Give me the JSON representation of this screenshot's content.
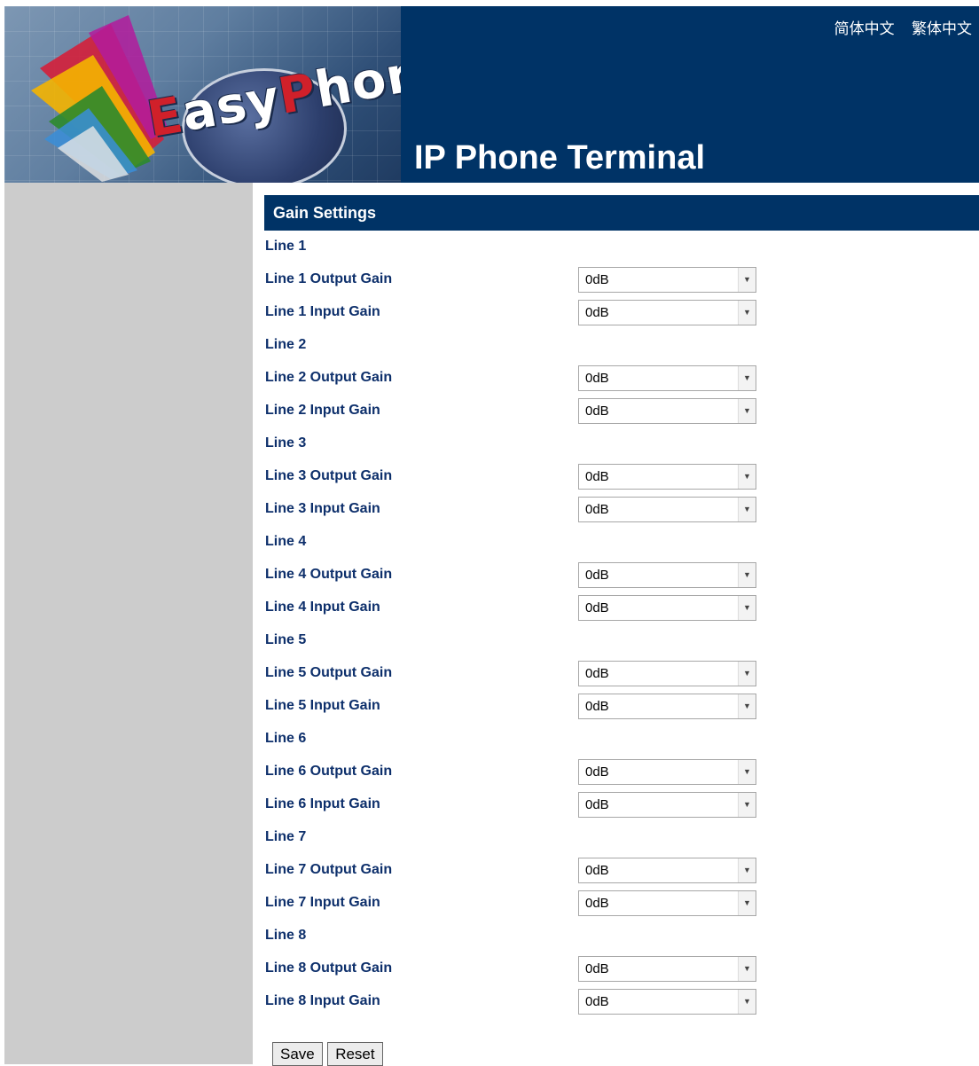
{
  "header": {
    "logo_text_start": "asy",
    "logo_letter_e": "E",
    "logo_letter_p": "P",
    "logo_text_end": "hone",
    "title": "IP Phone Terminal",
    "languages": [
      "简体中文",
      "繁体中文"
    ]
  },
  "section": {
    "title": "Gain Settings"
  },
  "rows": [
    {
      "label": "Line 1",
      "value": ""
    },
    {
      "label": "Line 1 Output Gain",
      "value": "0dB"
    },
    {
      "label": "Line 1 Input Gain",
      "value": "0dB"
    },
    {
      "label": "Line 2",
      "value": ""
    },
    {
      "label": "Line 2 Output Gain",
      "value": "0dB"
    },
    {
      "label": "Line 2 Input Gain",
      "value": "0dB"
    },
    {
      "label": "Line 3",
      "value": ""
    },
    {
      "label": "Line 3 Output Gain",
      "value": "0dB"
    },
    {
      "label": "Line 3 Input Gain",
      "value": "0dB"
    },
    {
      "label": "Line 4",
      "value": ""
    },
    {
      "label": "Line 4 Output Gain",
      "value": "0dB"
    },
    {
      "label": "Line 4 Input Gain",
      "value": "0dB"
    },
    {
      "label": "Line 5",
      "value": ""
    },
    {
      "label": "Line 5 Output Gain",
      "value": "0dB"
    },
    {
      "label": "Line 5 Input Gain",
      "value": "0dB"
    },
    {
      "label": "Line 6",
      "value": ""
    },
    {
      "label": "Line 6 Output Gain",
      "value": "0dB"
    },
    {
      "label": "Line 6 Input Gain",
      "value": "0dB"
    },
    {
      "label": "Line 7",
      "value": ""
    },
    {
      "label": "Line 7 Output Gain",
      "value": "0dB"
    },
    {
      "label": "Line 7 Input Gain",
      "value": "0dB"
    },
    {
      "label": "Line 8",
      "value": ""
    },
    {
      "label": "Line 8 Output Gain",
      "value": "0dB"
    },
    {
      "label": "Line 8 Input Gain",
      "value": "0dB"
    }
  ],
  "buttons": {
    "save": "Save",
    "reset": "Reset"
  },
  "colors": {
    "header": "#003366",
    "label": "#0d2f6b",
    "sidebar": "#cccccc"
  }
}
